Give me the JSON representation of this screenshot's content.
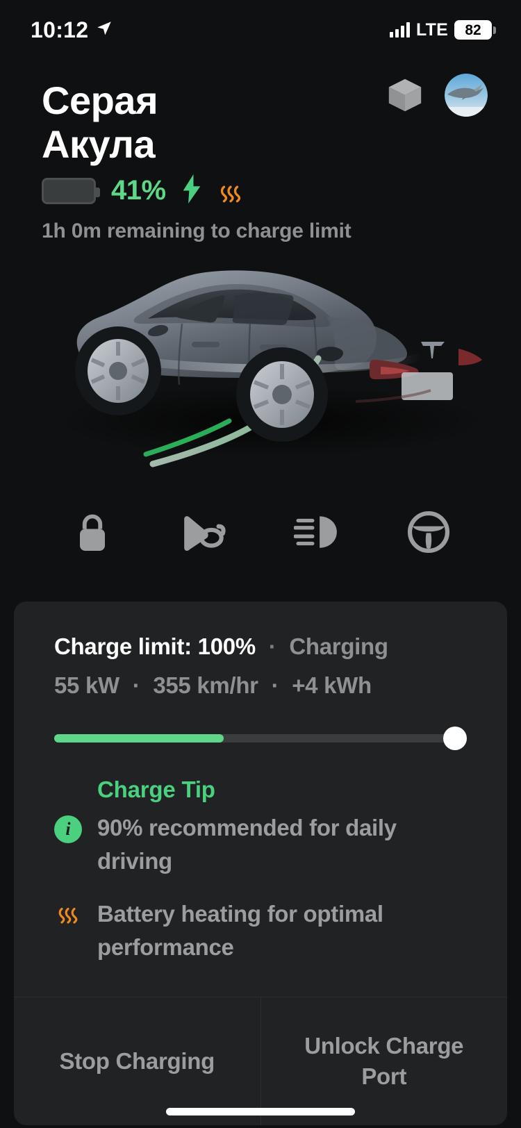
{
  "status_bar": {
    "time": "10:12",
    "location_icon": "location-arrow-icon",
    "network": "LTE",
    "battery_level": "82",
    "signal_icon": "signal-bars-icon"
  },
  "header": {
    "vehicle_name_line1": "Серая",
    "vehicle_name_line2": "Акула",
    "cube_icon": "cube-icon",
    "avatar_icon": "shark-avatar",
    "battery": {
      "percent_label": "41%",
      "percent_value": 41,
      "charging_icon": "lightning-bolt-icon",
      "heating_icon": "heat-waves-icon"
    },
    "remaining_text": "1h 0m remaining to charge limit"
  },
  "quick_actions": [
    {
      "name": "lock-button",
      "icon": "lock-icon"
    },
    {
      "name": "horn-button",
      "icon": "horn-icon"
    },
    {
      "name": "lights-button",
      "icon": "headlight-icon"
    },
    {
      "name": "steering-button",
      "icon": "steering-wheel-icon"
    }
  ],
  "charge_card": {
    "charge_limit_label": "Charge limit:",
    "charge_limit_value": "100%",
    "separator": "·",
    "status": "Charging",
    "stats": {
      "power": "55 kW",
      "rate": "355 km/hr",
      "added": "+4 kWh"
    },
    "slider": {
      "fill_percent": 41,
      "thumb_percent": 100
    },
    "tip_title": "Charge Tip",
    "tip_info_icon": "info-icon",
    "tip_text": "90% recommended for daily driving",
    "heat_icon": "heat-waves-icon",
    "heat_text": "Battery heating for optimal performance",
    "buttons": {
      "stop_charging": "Stop Charging",
      "unlock_port": "Unlock Charge Port"
    }
  },
  "colors": {
    "background": "#0f1011",
    "card": "#212223",
    "accent_green": "#4ad07f",
    "battery_green": "#5fd788",
    "heat_orange": "#f08a1e",
    "muted_text": "#8e9192"
  }
}
